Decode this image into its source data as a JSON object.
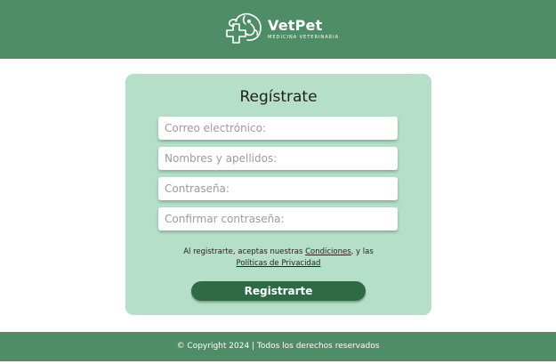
{
  "header": {
    "brand_name": "VetPet",
    "brand_subtitle": "MEDICINA VETERINARIA",
    "logo_icon": "dog-cross-logo-icon"
  },
  "form": {
    "title": "Regístrate",
    "fields": [
      {
        "placeholder": "Correo electrónico:",
        "value": ""
      },
      {
        "placeholder": "Nombres y apellidos:",
        "value": ""
      },
      {
        "placeholder": "Contraseña:",
        "value": ""
      },
      {
        "placeholder": "Confirmar contraseña:",
        "value": ""
      }
    ],
    "legal": {
      "prefix": "Al registrarte, aceptas nuestras ",
      "conditions_link": "Condiciones",
      "middle": ", y las",
      "privacy_link": "Políticas de Privacidad"
    },
    "submit_label": "Registrarte"
  },
  "footer": {
    "copyright_symbol": "©",
    "text": " Copyright 2024 | Todos los derechos reservados"
  },
  "colors": {
    "header_footer": "#4e8d65",
    "card": "#b5dfc8",
    "button": "#2e6b44"
  }
}
